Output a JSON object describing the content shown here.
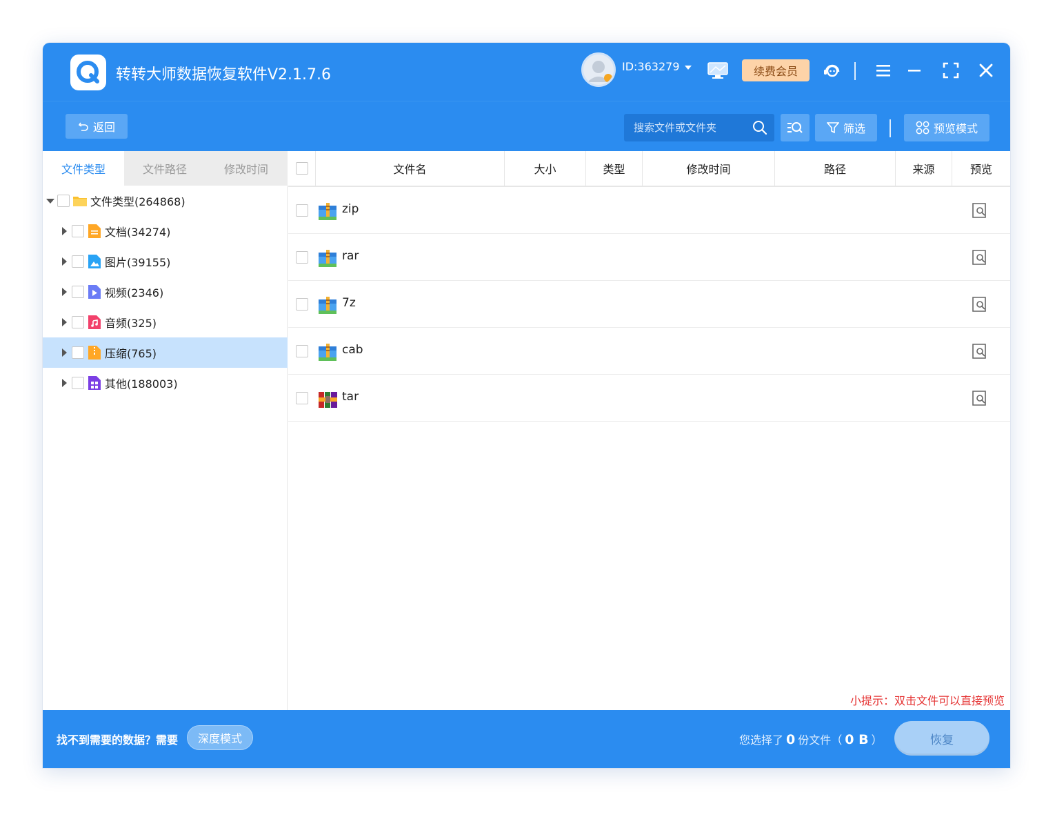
{
  "app": {
    "title": "转转大师数据恢复软件V2.1.7.6",
    "user_id": "ID:363279",
    "vip_label": "续费会员"
  },
  "toolbar": {
    "back_label": "返回",
    "search_placeholder": "搜索文件或文件夹",
    "filter_label": "筛选",
    "preview_mode_label": "预览模式"
  },
  "left_tabs": [
    "文件类型",
    "文件路径",
    "修改时间"
  ],
  "tree": {
    "root": "文件类型(264868)",
    "items": [
      {
        "label": "文档(34274)",
        "icon": "document-icon"
      },
      {
        "label": "图片(39155)",
        "icon": "image-icon"
      },
      {
        "label": "视频(2346)",
        "icon": "video-icon"
      },
      {
        "label": "音频(325)",
        "icon": "audio-icon"
      },
      {
        "label": "压缩(765)",
        "icon": "archive-icon"
      },
      {
        "label": "其他(188003)",
        "icon": "other-icon"
      }
    ],
    "selected_index": 4
  },
  "table": {
    "columns": [
      "文件名",
      "大小",
      "类型",
      "修改时间",
      "路径",
      "来源",
      "预览"
    ],
    "rows": [
      {
        "name": "zip"
      },
      {
        "name": "rar"
      },
      {
        "name": "7z"
      },
      {
        "name": "cab"
      },
      {
        "name": "tar"
      }
    ]
  },
  "tip": "小提示：双击文件可以直接预览",
  "bottom": {
    "hint": "找不到需要的数据？需要",
    "deep_mode_label": "深度模式",
    "selected_prefix": "您选择了",
    "selected_count": "0",
    "selected_mid": "份文件（",
    "selected_size": "0 B",
    "selected_suffix": "）",
    "recover_label": "恢复"
  },
  "colors": {
    "primary": "#2b8cf0",
    "selected_row": "#c7e2fd",
    "vip": "#fdd3a8",
    "tip": "#e53333"
  }
}
